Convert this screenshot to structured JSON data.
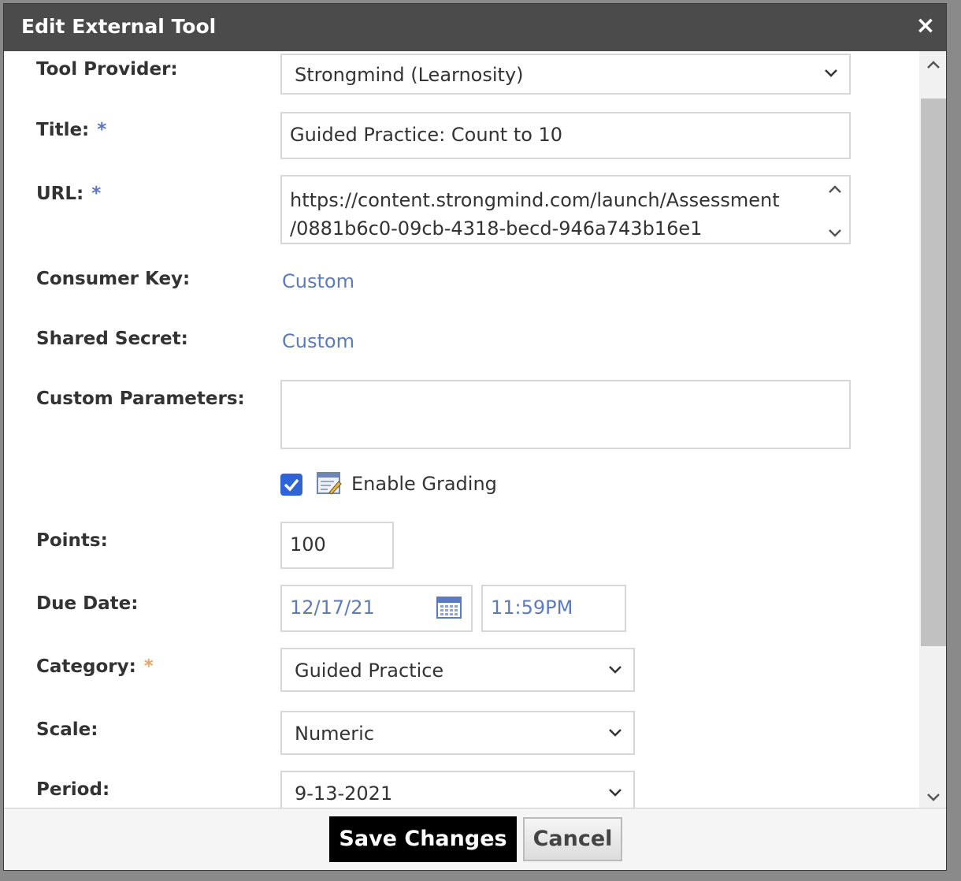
{
  "dialog": {
    "title": "Edit External Tool",
    "close_icon": "×"
  },
  "form": {
    "tool_provider": {
      "label": "Tool Provider:",
      "value": "Strongmind (Learnosity)"
    },
    "title": {
      "label": "Title:",
      "required_mark": "*",
      "value": "Guided Practice: Count to 10"
    },
    "url": {
      "label": "URL:",
      "required_mark": "*",
      "value": "https://content.strongmind.com/launch/Assessment\n/0881b6c0-09cb-4318-becd-946a743b16e1"
    },
    "consumer_key": {
      "label": "Consumer Key:",
      "value": "Custom"
    },
    "shared_secret": {
      "label": "Shared Secret:",
      "value": "Custom"
    },
    "custom_parameters": {
      "label": "Custom Parameters:",
      "value": ""
    },
    "enable_grading": {
      "label": "Enable Grading",
      "checked": true
    },
    "points": {
      "label": "Points:",
      "value": "100"
    },
    "due_date": {
      "label": "Due Date:",
      "date": "12/17/21",
      "time": "11:59PM"
    },
    "category": {
      "label": "Category:",
      "required_mark": "*",
      "value": "Guided Practice"
    },
    "scale": {
      "label": "Scale:",
      "value": "Numeric"
    },
    "period": {
      "label": "Period:",
      "value": "9-13-2021"
    }
  },
  "footer": {
    "save_label": "Save Changes",
    "cancel_label": "Cancel"
  },
  "colors": {
    "titlebar": "#4b4b4b",
    "link": "#5b7bc0",
    "checkbox": "#2f64d8",
    "save_button": "#000000"
  }
}
